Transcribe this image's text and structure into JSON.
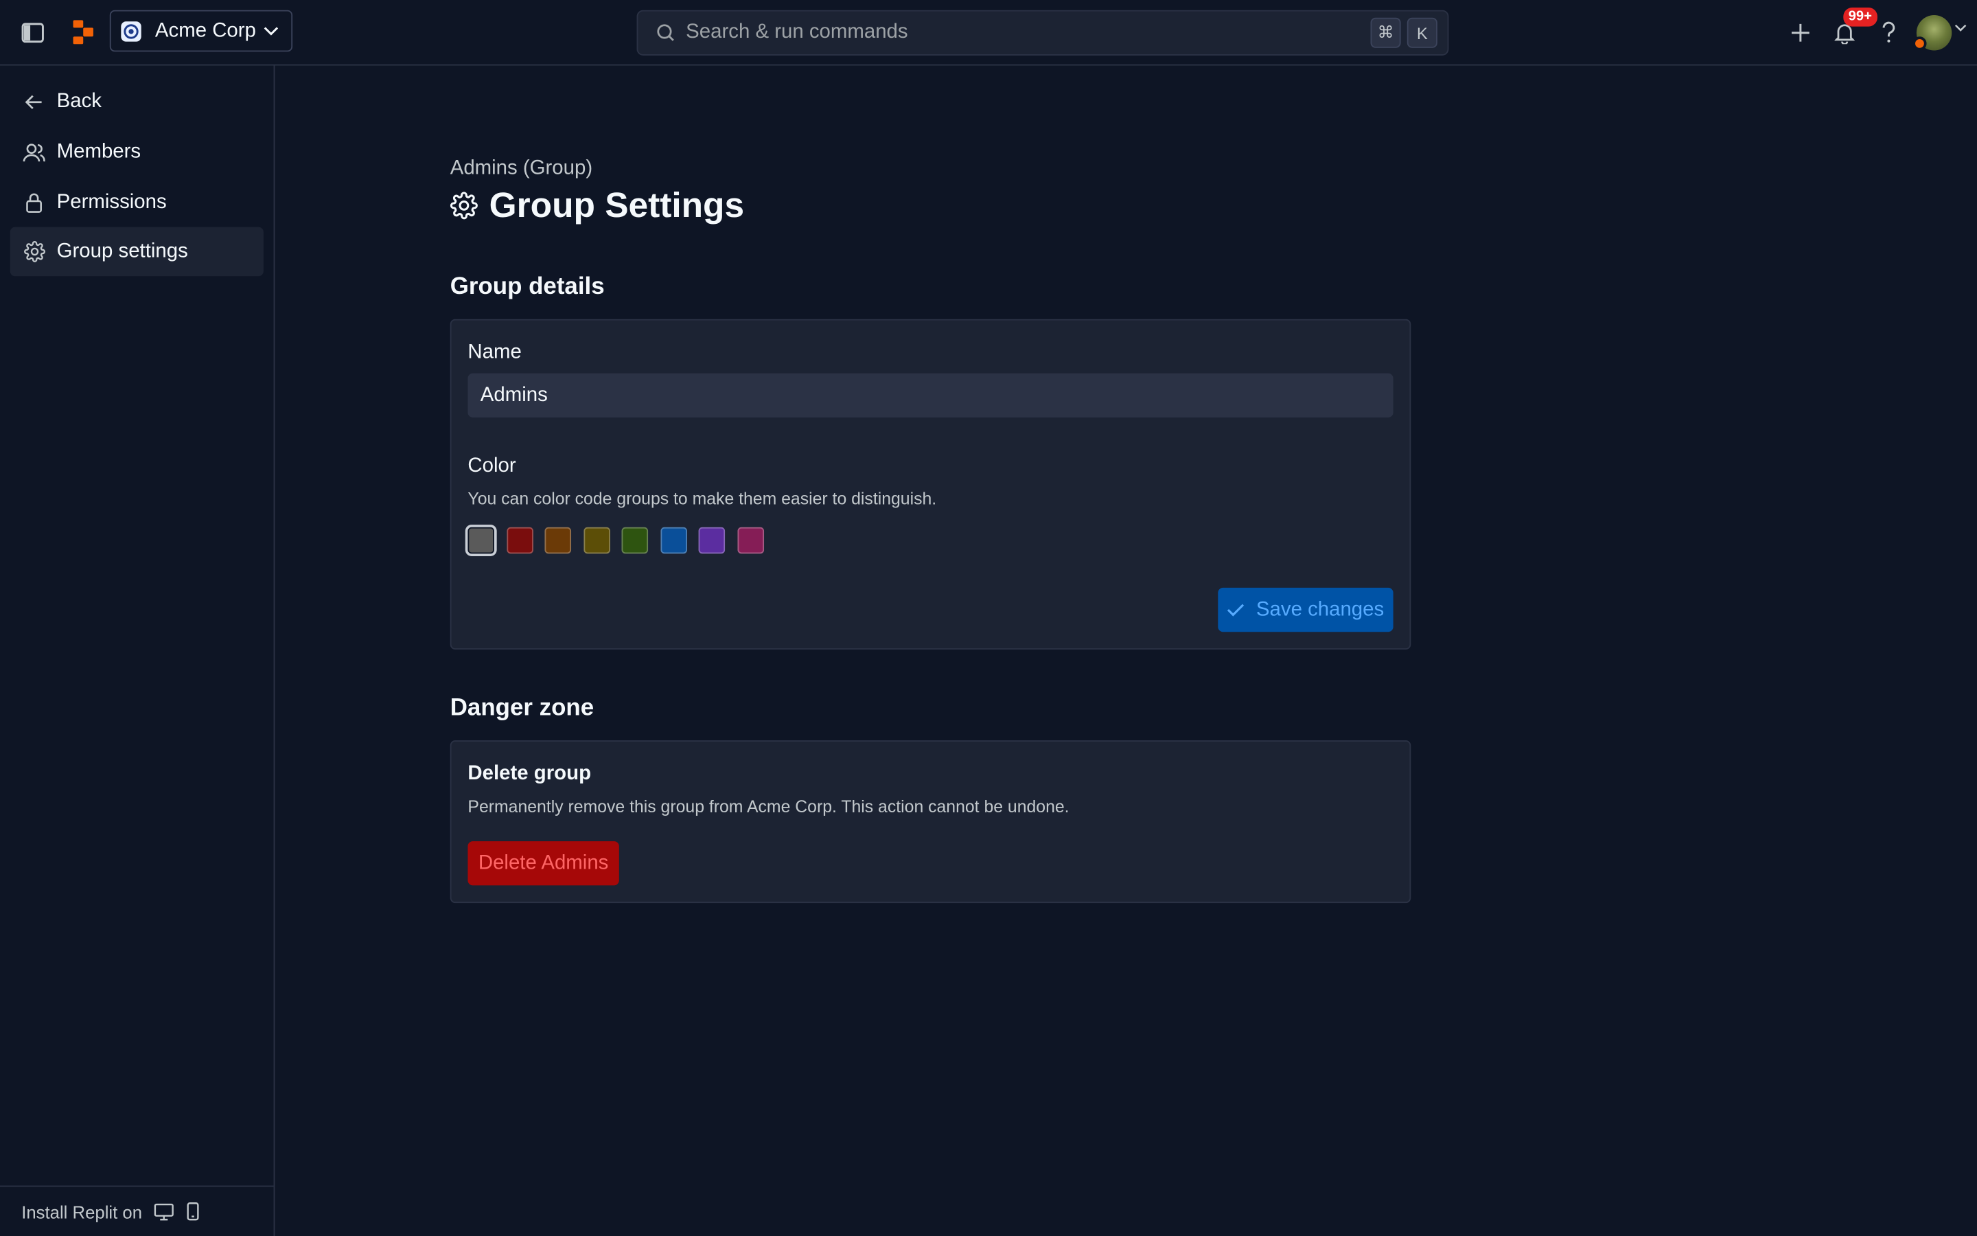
{
  "topbar": {
    "org_name": "Acme Corp",
    "search_placeholder": "Search & run commands",
    "shortcut_key_1": "⌘",
    "shortcut_key_2": "K",
    "notification_count": "99+",
    "icons": [
      "sidebar-toggle-icon",
      "replit-logo",
      "search-icon",
      "plus-icon",
      "bell-icon",
      "help-icon",
      "chevron-down-icon"
    ]
  },
  "sidebar": {
    "items": [
      {
        "label": "Back",
        "icon": "arrow-left-icon"
      },
      {
        "label": "Members",
        "icon": "users-icon"
      },
      {
        "label": "Permissions",
        "icon": "lock-icon"
      },
      {
        "label": "Group settings",
        "icon": "gear-icon",
        "active": true
      }
    ],
    "install_label": "Install Replit on"
  },
  "main": {
    "breadcrumb": "Admins (Group)",
    "title": "Group Settings",
    "group_details": {
      "heading": "Group details",
      "name_label": "Name",
      "name_value": "Admins",
      "color_label": "Color",
      "color_help": "You can color code groups to make them easier to distinguish.",
      "colors": [
        "#5a5a5a",
        "#7a0d0d",
        "#6b3a07",
        "#5c4e07",
        "#2e5410",
        "#0a4f99",
        "#5b2da0",
        "#851d56"
      ],
      "selected_color": "#5a5a5a",
      "save_label": "Save changes"
    },
    "danger_zone": {
      "heading": "Danger zone",
      "delete_title": "Delete group",
      "delete_desc": "Permanently remove this group from Acme Corp. This action cannot be undone.",
      "delete_button": "Delete Admins"
    }
  },
  "colors": {
    "background": "#0e1525",
    "surface": "#1c2333",
    "border": "#2b3245",
    "primary_button": "#0053a6",
    "danger_button": "#a60808",
    "brand_orange": "#f26207",
    "badge_red": "#e52222"
  }
}
